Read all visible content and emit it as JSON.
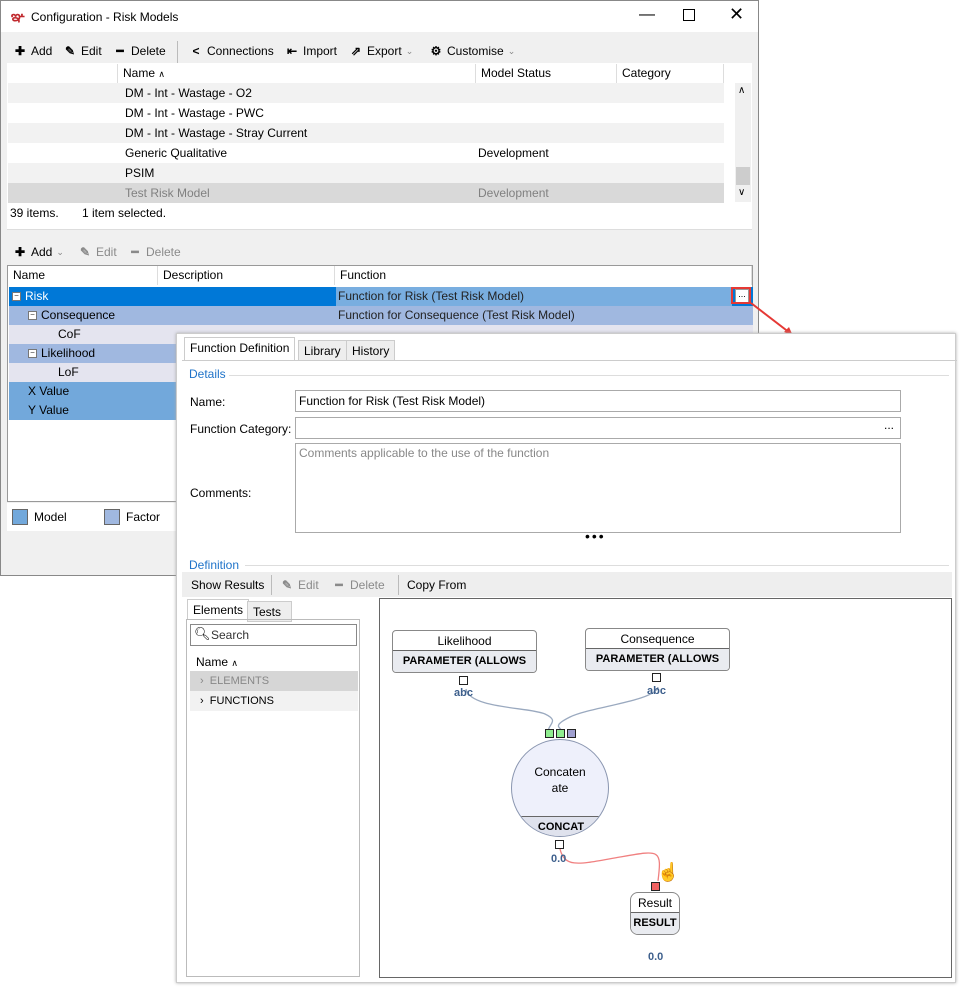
{
  "window": {
    "title": "Configuration - Risk Models"
  },
  "toolbar": {
    "add": "Add",
    "edit": "Edit",
    "delete": "Delete",
    "connections": "Connections",
    "import": "Import",
    "export": "Export",
    "customise": "Customise"
  },
  "models_grid": {
    "columns": [
      "Name",
      "Model Status",
      "Category"
    ],
    "rows": [
      {
        "name": "DM - Int - Wastage - O2",
        "status": "",
        "category": ""
      },
      {
        "name": "DM - Int - Wastage - PWC",
        "status": "",
        "category": ""
      },
      {
        "name": "DM - Int - Wastage - Stray Current",
        "status": "",
        "category": ""
      },
      {
        "name": "Generic Qualitative",
        "status": "Development",
        "category": ""
      },
      {
        "name": "PSIM",
        "status": "",
        "category": ""
      },
      {
        "name": "Test Risk Model",
        "status": "Development",
        "category": "",
        "selected": true
      }
    ]
  },
  "status": {
    "count": "39 items.",
    "selected": "1 item selected."
  },
  "tree_toolbar": {
    "add": "Add",
    "edit": "Edit",
    "delete": "Delete"
  },
  "tree": {
    "columns": [
      "Name",
      "Description",
      "Function"
    ],
    "rows": [
      {
        "name": "Risk",
        "function": "Function for Risk (Test Risk Model)"
      },
      {
        "name": "Consequence",
        "function": "Function for Consequence (Test Risk Model)"
      },
      {
        "name": "CoF",
        "function": ""
      },
      {
        "name": "Likelihood",
        "function": ""
      },
      {
        "name": "LoF",
        "function": ""
      },
      {
        "name": "X Value",
        "function": ""
      },
      {
        "name": "Y Value",
        "function": ""
      }
    ],
    "ellipsis": "..."
  },
  "legend": {
    "model": "Model",
    "factor": "Factor",
    "model_color": "#72a8db",
    "factor_color": "#a0b8e0"
  },
  "popup": {
    "tabs": [
      "Function Definition",
      "Library",
      "History"
    ],
    "details_label": "Details",
    "name_label": "Name:",
    "name_value": "Function for Risk (Test Risk Model)",
    "category_label": "Function Category:",
    "category_value": "",
    "category_btn": "...",
    "comments_label": "Comments:",
    "comments_placeholder": "Comments applicable to the use of the function",
    "definition_label": "Definition",
    "def_toolbar": {
      "show_results": "Show Results",
      "edit": "Edit",
      "delete": "Delete",
      "copy_from": "Copy From"
    },
    "side_tabs": [
      "Elements",
      "Tests"
    ],
    "search_placeholder": "Search",
    "list_header": "Name",
    "list_items": [
      "ELEMENTS",
      "FUNCTIONS"
    ],
    "diagram": {
      "likelihood": {
        "title": "Likelihood",
        "type": "PARAMETER (ALLOWS N...",
        "out": "abc"
      },
      "consequence": {
        "title": "Consequence",
        "type": "PARAMETER (ALLOWS N...",
        "out": "abc"
      },
      "concat": {
        "title1": "Concaten",
        "title2": "ate",
        "type": "CONCAT",
        "out": "0.0"
      },
      "result": {
        "title": "Result",
        "type": "RESULT",
        "out": "0.0"
      }
    }
  }
}
